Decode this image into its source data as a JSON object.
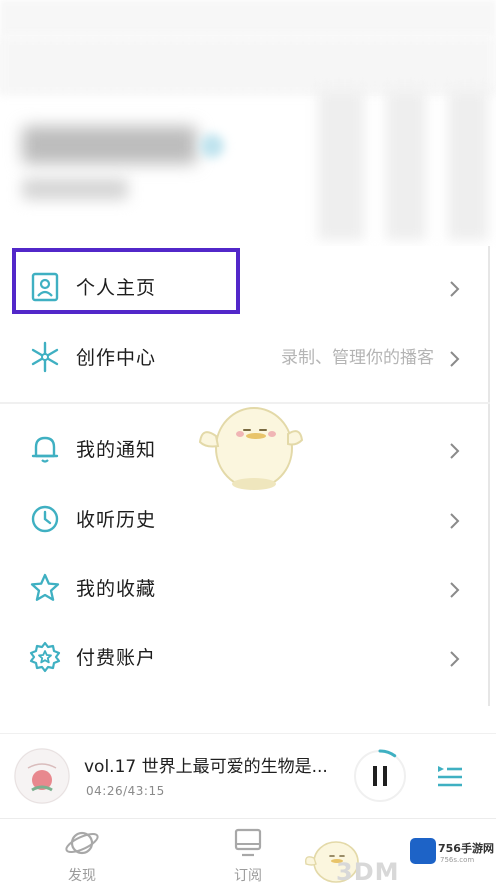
{
  "menu": {
    "items": [
      {
        "label": "个人主页",
        "hint": ""
      },
      {
        "label": "创作中心",
        "hint": "录制、管理你的播客"
      },
      {
        "label": "我的通知",
        "hint": ""
      },
      {
        "label": "收听历史",
        "hint": ""
      },
      {
        "label": "我的收藏",
        "hint": ""
      },
      {
        "label": "付费账户",
        "hint": ""
      }
    ]
  },
  "player": {
    "title": "vol.17 世界上最可爱的生物是...",
    "time": "04:26/43:15",
    "progress": 0.1
  },
  "tabs": [
    {
      "label": "发现",
      "icon": "planet-icon"
    },
    {
      "label": "订阅",
      "icon": "screen-icon"
    }
  ],
  "watermark": {
    "brand": "3DM",
    "site": "756手游网",
    "url": "756s.com"
  },
  "colors": {
    "accent": "#3fb0c2",
    "highlight": "#5227c9"
  }
}
